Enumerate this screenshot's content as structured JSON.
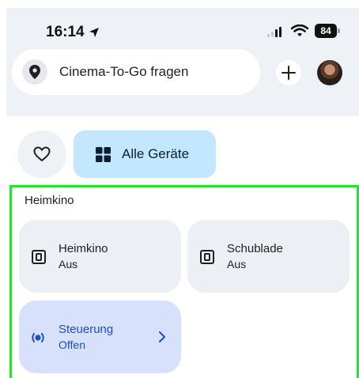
{
  "status_bar": {
    "time": "16:14",
    "battery": "84",
    "icons": [
      "location-arrow-icon",
      "cellular-signal-icon",
      "wifi-icon",
      "battery-icon"
    ]
  },
  "search": {
    "text": "Cinema-To-Go fragen",
    "icon": "location-pin-icon"
  },
  "header_actions": {
    "add_icon": "plus-icon",
    "avatar": "avatar"
  },
  "filters": {
    "favorites_icon": "heart-icon",
    "all_devices_label": "Alle Geräte",
    "all_devices_icon": "grid-icon"
  },
  "room": {
    "title": "Heimkino",
    "tiles": [
      {
        "name": "Heimkino",
        "state": "Aus",
        "icon": "switch-outlet-icon"
      },
      {
        "name": "Schublade",
        "state": "Aus",
        "icon": "switch-outlet-icon"
      },
      {
        "name": "Steuerung",
        "state": "Offen",
        "icon": "radio-signal-icon",
        "chevron": "chevron-right-icon"
      }
    ]
  },
  "colors": {
    "top_background": "#eef1f6",
    "all_devices_chip": "#c2e7ff",
    "tile_background": "#eceff4",
    "active_tile": "#d8e1fb",
    "active_text": "#1b4fbf",
    "highlight_frame": "#22e622"
  }
}
